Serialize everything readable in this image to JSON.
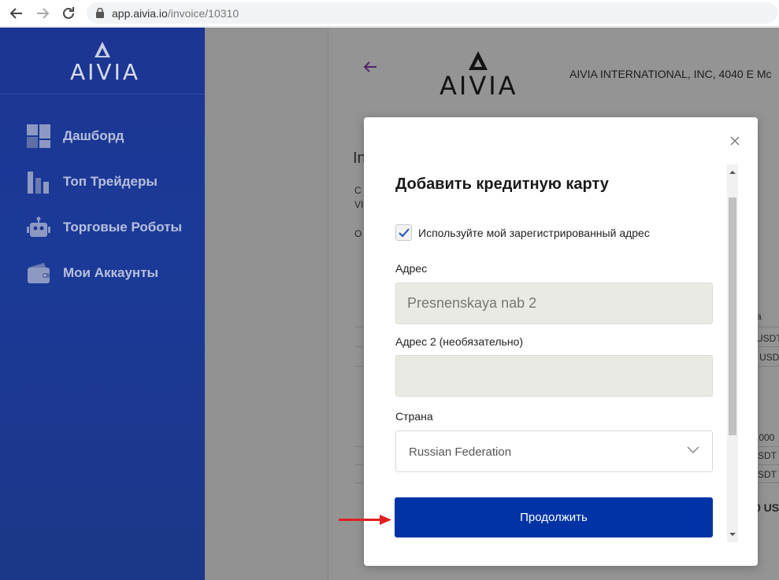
{
  "browser": {
    "url_host": "app.aivia.io",
    "url_path": "/invoice/10310"
  },
  "sidebar": {
    "logo": "AIVIA",
    "items": [
      {
        "label": "Дашборд",
        "icon": "dashboard-icon"
      },
      {
        "label": "Топ Трейдеры",
        "icon": "bar-chart-icon"
      },
      {
        "label": "Торговые Роботы",
        "icon": "robot-icon"
      },
      {
        "label": "Мои Аккаунты",
        "icon": "wallet-icon"
      }
    ]
  },
  "main": {
    "logo": "AIVIA",
    "company": "AIVIA INTERNATIONAL, INC, 4040 E Mc",
    "bg_fragments": {
      "heading": "In",
      "line1": "C",
      "line2": "VI",
      "line3": "O",
      "col_header": "а",
      "r1": "USDT",
      "r2": "USD",
      "r3": ".000",
      "r4": "SDT",
      "r5": "SDT",
      "total": "0 US"
    }
  },
  "modal": {
    "title": "Добавить кредитную карту",
    "checkbox_label": "Используйте мой зарегистрированный адрес",
    "checkbox_checked": true,
    "address_label": "Адрес",
    "address_value": "Presnenskaya nab 2",
    "address2_label": "Адрес 2 (необязательно)",
    "address2_value": "",
    "country_label": "Страна",
    "country_value": "Russian Federation",
    "submit_label": "Продолжить"
  },
  "colors": {
    "sidebar": "#1d3592",
    "primary_button": "#0034a6",
    "annotation_arrow": "#e02020"
  }
}
